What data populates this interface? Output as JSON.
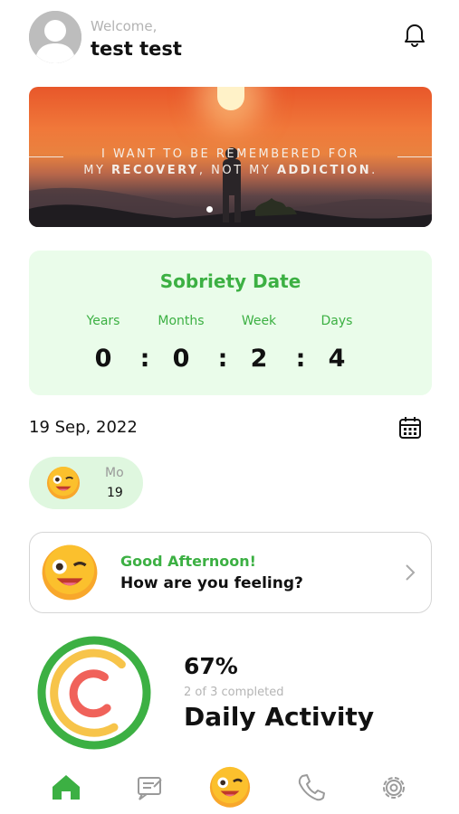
{
  "header": {
    "welcome": "Welcome,",
    "username": "test test",
    "avatar_icon": "user-avatar-icon",
    "notification_icon": "bell-icon"
  },
  "banner": {
    "quote_line1": "I WANT TO BE REMEMBERED FOR",
    "quote_line2_a": "MY ",
    "quote_line2_b": "RECOVERY",
    "quote_line2_c": ", NOT MY ",
    "quote_line2_d": "ADDICTION",
    "quote_line2_e": "."
  },
  "sobriety": {
    "title": "Sobriety Date",
    "labels": [
      "Years",
      "Months",
      "Week",
      "Days"
    ],
    "values": [
      "0",
      "0",
      "2",
      "4"
    ],
    "separator": ":"
  },
  "date": {
    "text": "19 Sep, 2022",
    "calendar_icon": "calendar-icon"
  },
  "day_chip": {
    "day": "Mo",
    "num": "19",
    "emoji": "winking-face-icon"
  },
  "feeling_card": {
    "greeting": "Good Afternoon!",
    "question": "How are you feeling?",
    "emoji": "winking-face-icon",
    "chevron": "chevron-right-icon"
  },
  "activity": {
    "percent": "67%",
    "completed_text": "2  of 3 completed",
    "title": "Daily Activity",
    "progress": 0.67
  },
  "nav": {
    "items": [
      "home-icon",
      "journal-icon",
      "mood-icon",
      "phone-icon",
      "settings-icon"
    ],
    "active": "home-icon"
  },
  "colors": {
    "accent_green": "#3cb043",
    "sobriety_bg": "#eafcea",
    "chip_bg": "#dff7df",
    "ring_green": "#3cb043",
    "ring_yellow": "#f7c44a",
    "ring_red": "#f0625a"
  }
}
